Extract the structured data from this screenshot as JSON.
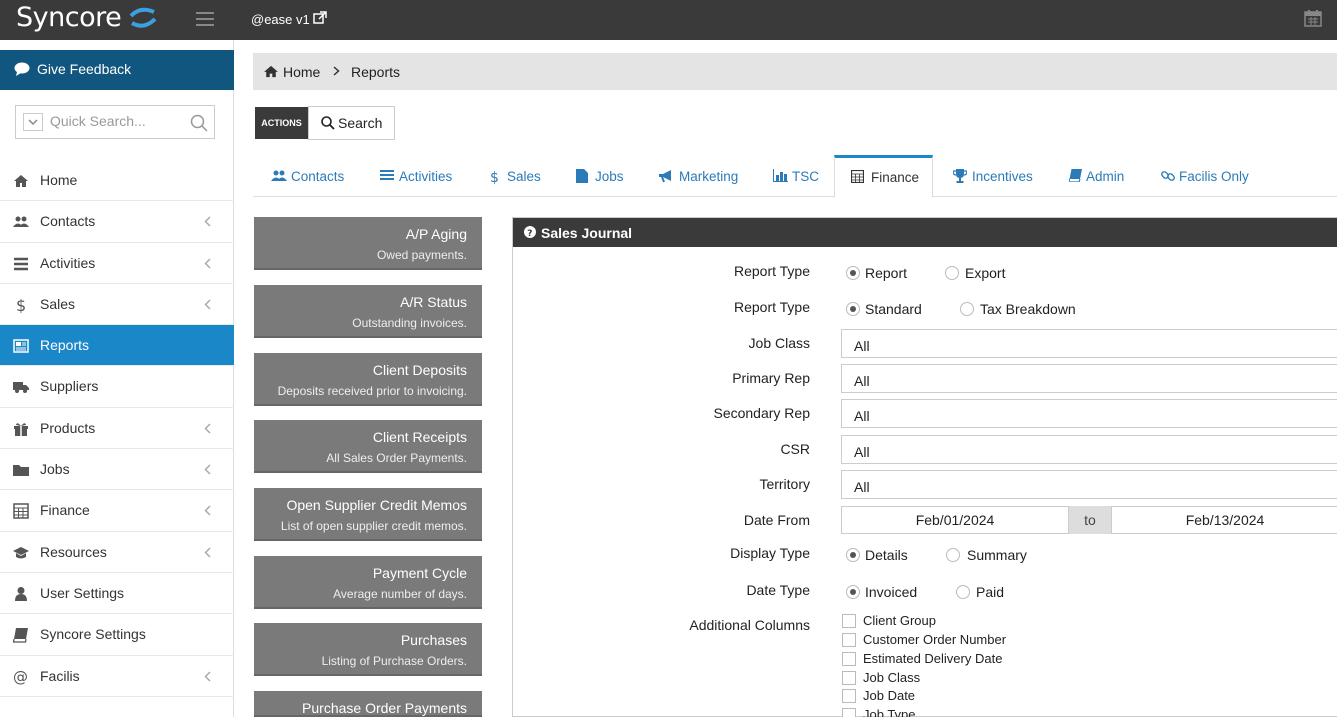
{
  "header": {
    "logo": "Syncore",
    "app_name": "@ease v1"
  },
  "sidebar": {
    "feedback_label": "Give Feedback",
    "quick_search_placeholder": "Quick Search...",
    "items": [
      {
        "label": "Home",
        "icon": "home-icon",
        "has_chevron": false
      },
      {
        "label": "Contacts",
        "icon": "users-icon",
        "has_chevron": true
      },
      {
        "label": "Activities",
        "icon": "list-icon",
        "has_chevron": true
      },
      {
        "label": "Sales",
        "icon": "dollar-icon",
        "has_chevron": true
      },
      {
        "label": "Reports",
        "icon": "newspaper-icon",
        "has_chevron": false,
        "active": true
      },
      {
        "label": "Suppliers",
        "icon": "truck-icon",
        "has_chevron": false
      },
      {
        "label": "Products",
        "icon": "gift-icon",
        "has_chevron": true
      },
      {
        "label": "Jobs",
        "icon": "folder-icon",
        "has_chevron": true
      },
      {
        "label": "Finance",
        "icon": "calculator-icon",
        "has_chevron": true
      },
      {
        "label": "Resources",
        "icon": "graduation-cap-icon",
        "has_chevron": true
      },
      {
        "label": "User Settings",
        "icon": "user-icon",
        "has_chevron": false
      },
      {
        "label": "Syncore Settings",
        "icon": "book-icon",
        "has_chevron": false
      },
      {
        "label": "Facilis",
        "icon": "at-icon",
        "has_chevron": true
      }
    ]
  },
  "breadcrumb": {
    "home": "Home",
    "current": "Reports"
  },
  "toolbar": {
    "actions_label": "ACTIONS",
    "search_label": "Search"
  },
  "tabs": [
    {
      "label": "Contacts",
      "icon": "users-icon"
    },
    {
      "label": "Activities",
      "icon": "list-icon"
    },
    {
      "label": "Sales",
      "icon": "dollar-icon"
    },
    {
      "label": "Jobs",
      "icon": "file-icon"
    },
    {
      "label": "Marketing",
      "icon": "bullhorn-icon"
    },
    {
      "label": "TSC",
      "icon": "bar-chart-icon"
    },
    {
      "label": "Finance",
      "icon": "calculator-icon",
      "active": true
    },
    {
      "label": "Incentives",
      "icon": "trophy-icon"
    },
    {
      "label": "Admin",
      "icon": "book-icon"
    },
    {
      "label": "Facilis Only",
      "icon": "link-icon"
    }
  ],
  "reports": [
    {
      "title": "A/P Aging",
      "desc": "Owed payments."
    },
    {
      "title": "A/R Status",
      "desc": "Outstanding invoices."
    },
    {
      "title": "Client Deposits",
      "desc": "Deposits received prior to invoicing."
    },
    {
      "title": "Client Receipts",
      "desc": "All Sales Order Payments."
    },
    {
      "title": "Open Supplier Credit Memos",
      "desc": "List of open supplier credit memos."
    },
    {
      "title": "Payment Cycle",
      "desc": "Average number of days."
    },
    {
      "title": "Purchases",
      "desc": "Listing of Purchase Orders."
    },
    {
      "title": "Purchase Order Payments",
      "desc": ""
    }
  ],
  "panel": {
    "title": "Sales Journal",
    "report_type_1": {
      "label": "Report Type",
      "options": [
        "Report",
        "Export"
      ],
      "selected": "Report"
    },
    "report_type_2": {
      "label": "Report Type",
      "options": [
        "Standard",
        "Tax Breakdown"
      ],
      "selected": "Standard"
    },
    "job_class": {
      "label": "Job Class",
      "value": "All"
    },
    "primary_rep": {
      "label": "Primary Rep",
      "value": "All"
    },
    "secondary_rep": {
      "label": "Secondary Rep",
      "value": "All"
    },
    "csr": {
      "label": "CSR",
      "value": "All"
    },
    "territory": {
      "label": "Territory",
      "value": "All"
    },
    "date_from": {
      "label": "Date From",
      "from": "Feb/01/2024",
      "to_label": "to",
      "to": "Feb/13/2024"
    },
    "display_type": {
      "label": "Display Type",
      "options": [
        "Details",
        "Summary"
      ],
      "selected": "Details"
    },
    "date_type": {
      "label": "Date Type",
      "options": [
        "Invoiced",
        "Paid"
      ],
      "selected": "Invoiced"
    },
    "additional_columns": {
      "label": "Additional Columns",
      "items": [
        "Client Group",
        "Customer Order Number",
        "Estimated Delivery Date",
        "Job Class",
        "Job Date",
        "Job Type"
      ]
    }
  }
}
